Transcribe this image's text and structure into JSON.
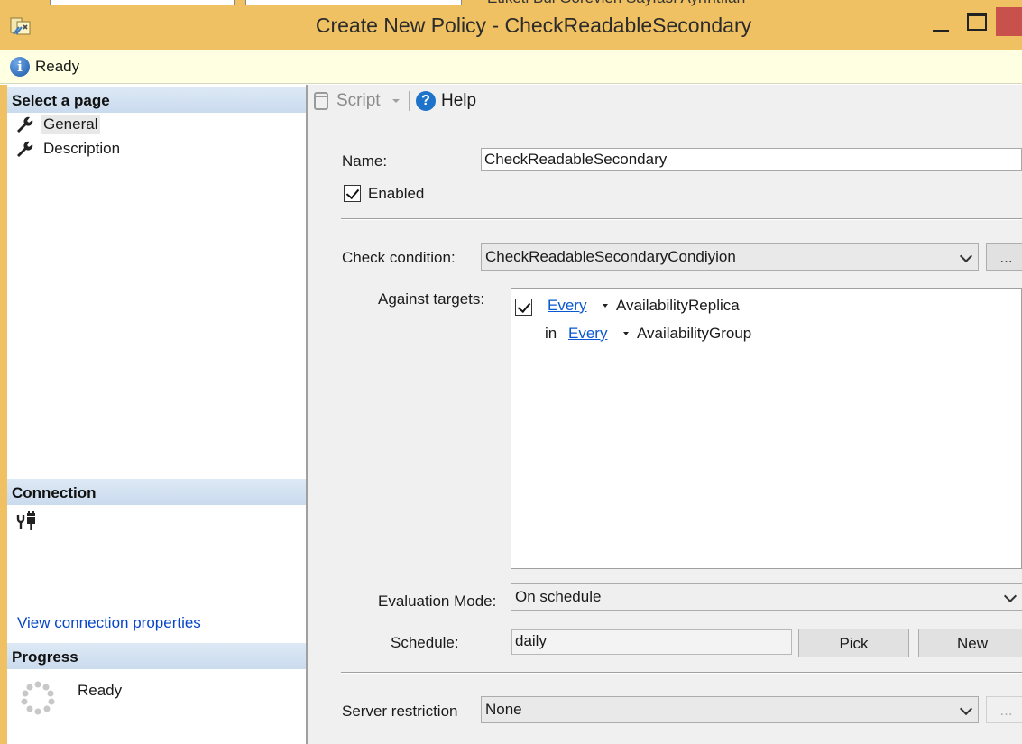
{
  "background_window": {
    "tabs_peek": "Etiketi     Bul    Görevleri    Sayfası   Ayrıntıları"
  },
  "window": {
    "title": "Create New Policy - CheckReadableSecondary",
    "title_bar_color": "#f0c163",
    "close_color": "#c9514b"
  },
  "status": {
    "text": "Ready",
    "icon": "info-icon"
  },
  "left_pane": {
    "select_page_header": "Select a page",
    "pages": [
      {
        "label": "General",
        "icon": "wrench-icon",
        "selected": true
      },
      {
        "label": "Description",
        "icon": "wrench-icon",
        "selected": false
      }
    ],
    "connection_header": "Connection",
    "connection_icon": "connection-plug-icon",
    "view_connection_link": "View connection properties",
    "progress_header": "Progress",
    "progress_status": "Ready"
  },
  "toolbar": {
    "script_label": "Script",
    "help_label": "Help"
  },
  "form": {
    "name_label": "Name:",
    "name_value": "CheckReadableSecondary",
    "enabled_label": "Enabled",
    "enabled_checked": true,
    "check_condition_label": "Check condition:",
    "check_condition_value": "CheckReadableSecondaryCondiyion",
    "ellipsis_label": "...",
    "against_targets_label": "Against targets:",
    "targets": {
      "line1": {
        "checked": true,
        "qualifier": "Every",
        "target": "AvailabilityReplica"
      },
      "line2": {
        "prefix": "in",
        "qualifier": "Every",
        "target": "AvailabilityGroup"
      }
    },
    "evaluation_mode_label": "Evaluation Mode:",
    "evaluation_mode_value": "On schedule",
    "schedule_label": "Schedule:",
    "schedule_value": "daily",
    "pick_label": "Pick",
    "new_label": "New",
    "server_restriction_label": "Server restriction",
    "server_restriction_value": "None",
    "server_restriction_ellipsis": "..."
  },
  "colors": {
    "link": "#0a58d0",
    "section_header": "#cadbee",
    "status_bar": "#ffffe1"
  }
}
